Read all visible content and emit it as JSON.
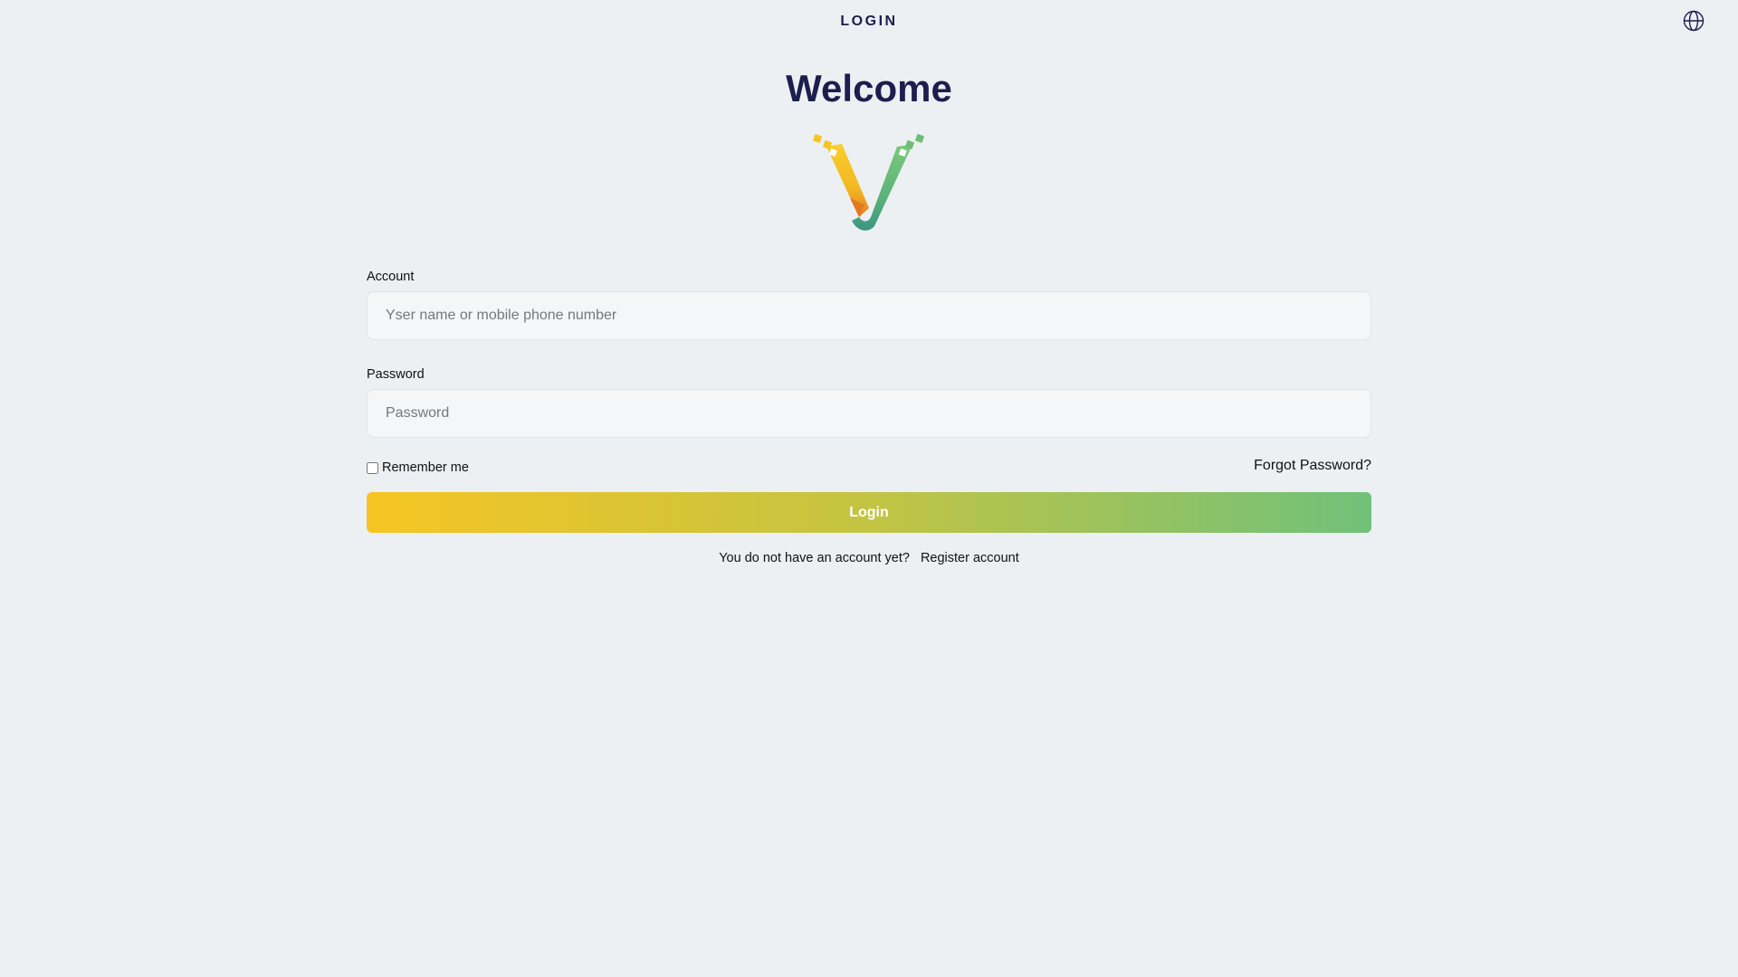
{
  "header": {
    "title": "LOGIN",
    "language_icon": "globe-icon"
  },
  "welcome": {
    "heading": "Welcome",
    "logo": "v-logo",
    "logo_colors": [
      "#f6c523",
      "#e8832a",
      "#6dbe74",
      "#3f9a82"
    ]
  },
  "form": {
    "account": {
      "label": "Account",
      "value": "",
      "placeholder": "Yser name or mobile phone number"
    },
    "password": {
      "label": "Password",
      "value": "",
      "placeholder": "Password"
    },
    "remember_me": {
      "label": "Remember me",
      "checked": false
    },
    "forgot_password": "Forgot Password?",
    "submit_label": "Login",
    "submit_gradient": [
      "#f6c523",
      "#70c17a"
    ]
  },
  "footer": {
    "prompt": "You do not have an account yet?",
    "register_link": "Register account"
  },
  "colors": {
    "background": "#ecf0f3",
    "heading": "#1c1e4e"
  }
}
